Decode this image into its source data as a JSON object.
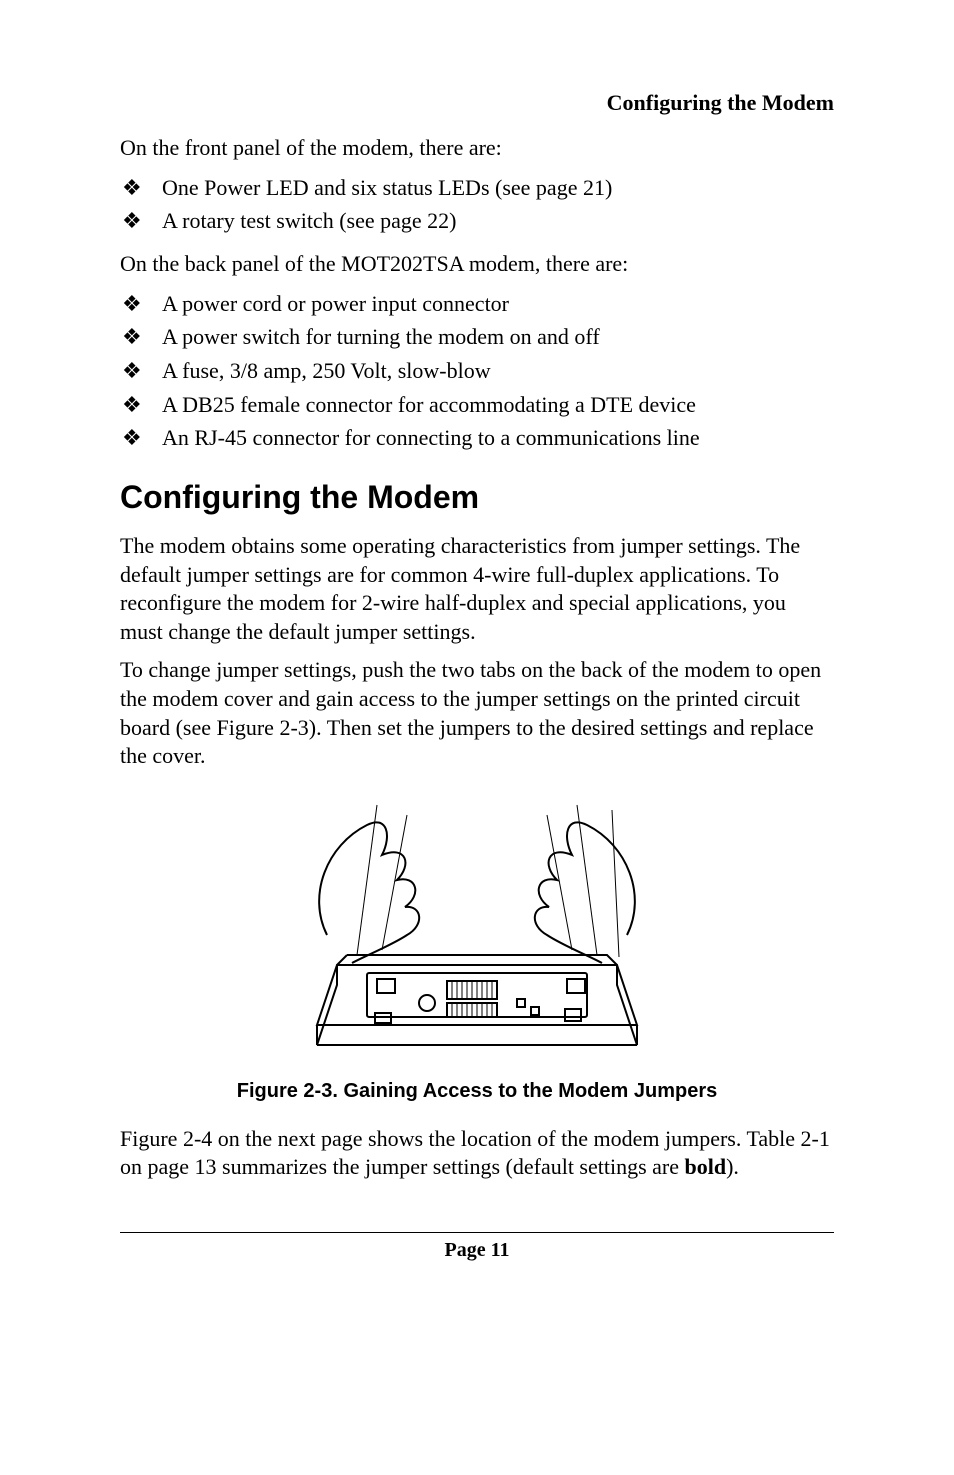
{
  "running_head": "Configuring the Modem",
  "intro_front": "On the front panel of the modem, there are:",
  "front_bullets": [
    "One Power LED and six status LEDs (see page 21)",
    "A rotary test switch (see page 22)"
  ],
  "intro_back": "On the back panel of the MOT202TSA modem, there are:",
  "back_bullets": [
    "A power cord or power input connector",
    "A power switch for turning the modem on and off",
    "A fuse, 3/8 amp, 250 Volt, slow-blow",
    "A DB25 female connector for accommodating a DTE device",
    "An RJ-45 connector for connecting to a communications line"
  ],
  "heading2": "Configuring the Modem",
  "para1": "The modem obtains some operating characteristics from jumper settings. The default jumper settings are for common 4-wire full-duplex applications. To reconfigure the modem for 2-wire half-duplex and special applications, you must change the default jumper settings.",
  "para2": "To change jumper settings, push the two tabs on the back of the modem to open the modem cover and gain access to the jumper settings on the printed circuit board (see Figure 2-3). Then set the jumpers to the desired settings and replace the cover.",
  "figure_caption": "Figure 2-3. Gaining Access to the Modem Jumpers",
  "para3_pre": "Figure 2-4 on the next page shows the location of the modem jumpers. Table 2-1 on page 13 summarizes the jumper settings (default settings are ",
  "para3_bold": "bold",
  "para3_post": ").",
  "footer": "Page 11",
  "bullet_glyph": "❖"
}
